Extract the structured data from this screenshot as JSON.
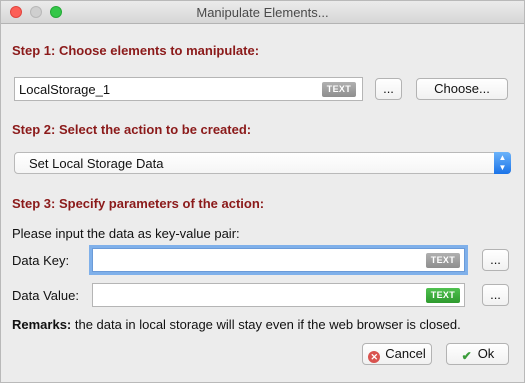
{
  "window": {
    "title": "Manipulate Elements..."
  },
  "step1": {
    "heading": "Step 1: Choose elements to manipulate:",
    "element_value": "LocalStorage_1",
    "element_badge": "TEXT",
    "more_label": "...",
    "choose_label": "Choose..."
  },
  "step2": {
    "heading": "Step 2: Select the action to be created:",
    "action_value": "Set Local Storage Data"
  },
  "step3": {
    "heading": "Step 3: Specify parameters of the action:",
    "instruction": "Please input the data as key-value pair:",
    "key_label": "Data Key:",
    "key_value": "",
    "key_badge": "TEXT",
    "key_more": "...",
    "value_label": "Data Value:",
    "value_value": "",
    "value_badge": "TEXT",
    "value_more": "..."
  },
  "remarks": {
    "bold": "Remarks:",
    "text": " the data in local storage will stay even if the web browser is closed."
  },
  "footer": {
    "cancel_label": "Cancel",
    "ok_label": "Ok"
  },
  "colors": {
    "heading": "#8b1a1a",
    "accent": "#1a73e8",
    "badge_gray": "#9a9a9a",
    "badge_green": "#3aa83a"
  }
}
